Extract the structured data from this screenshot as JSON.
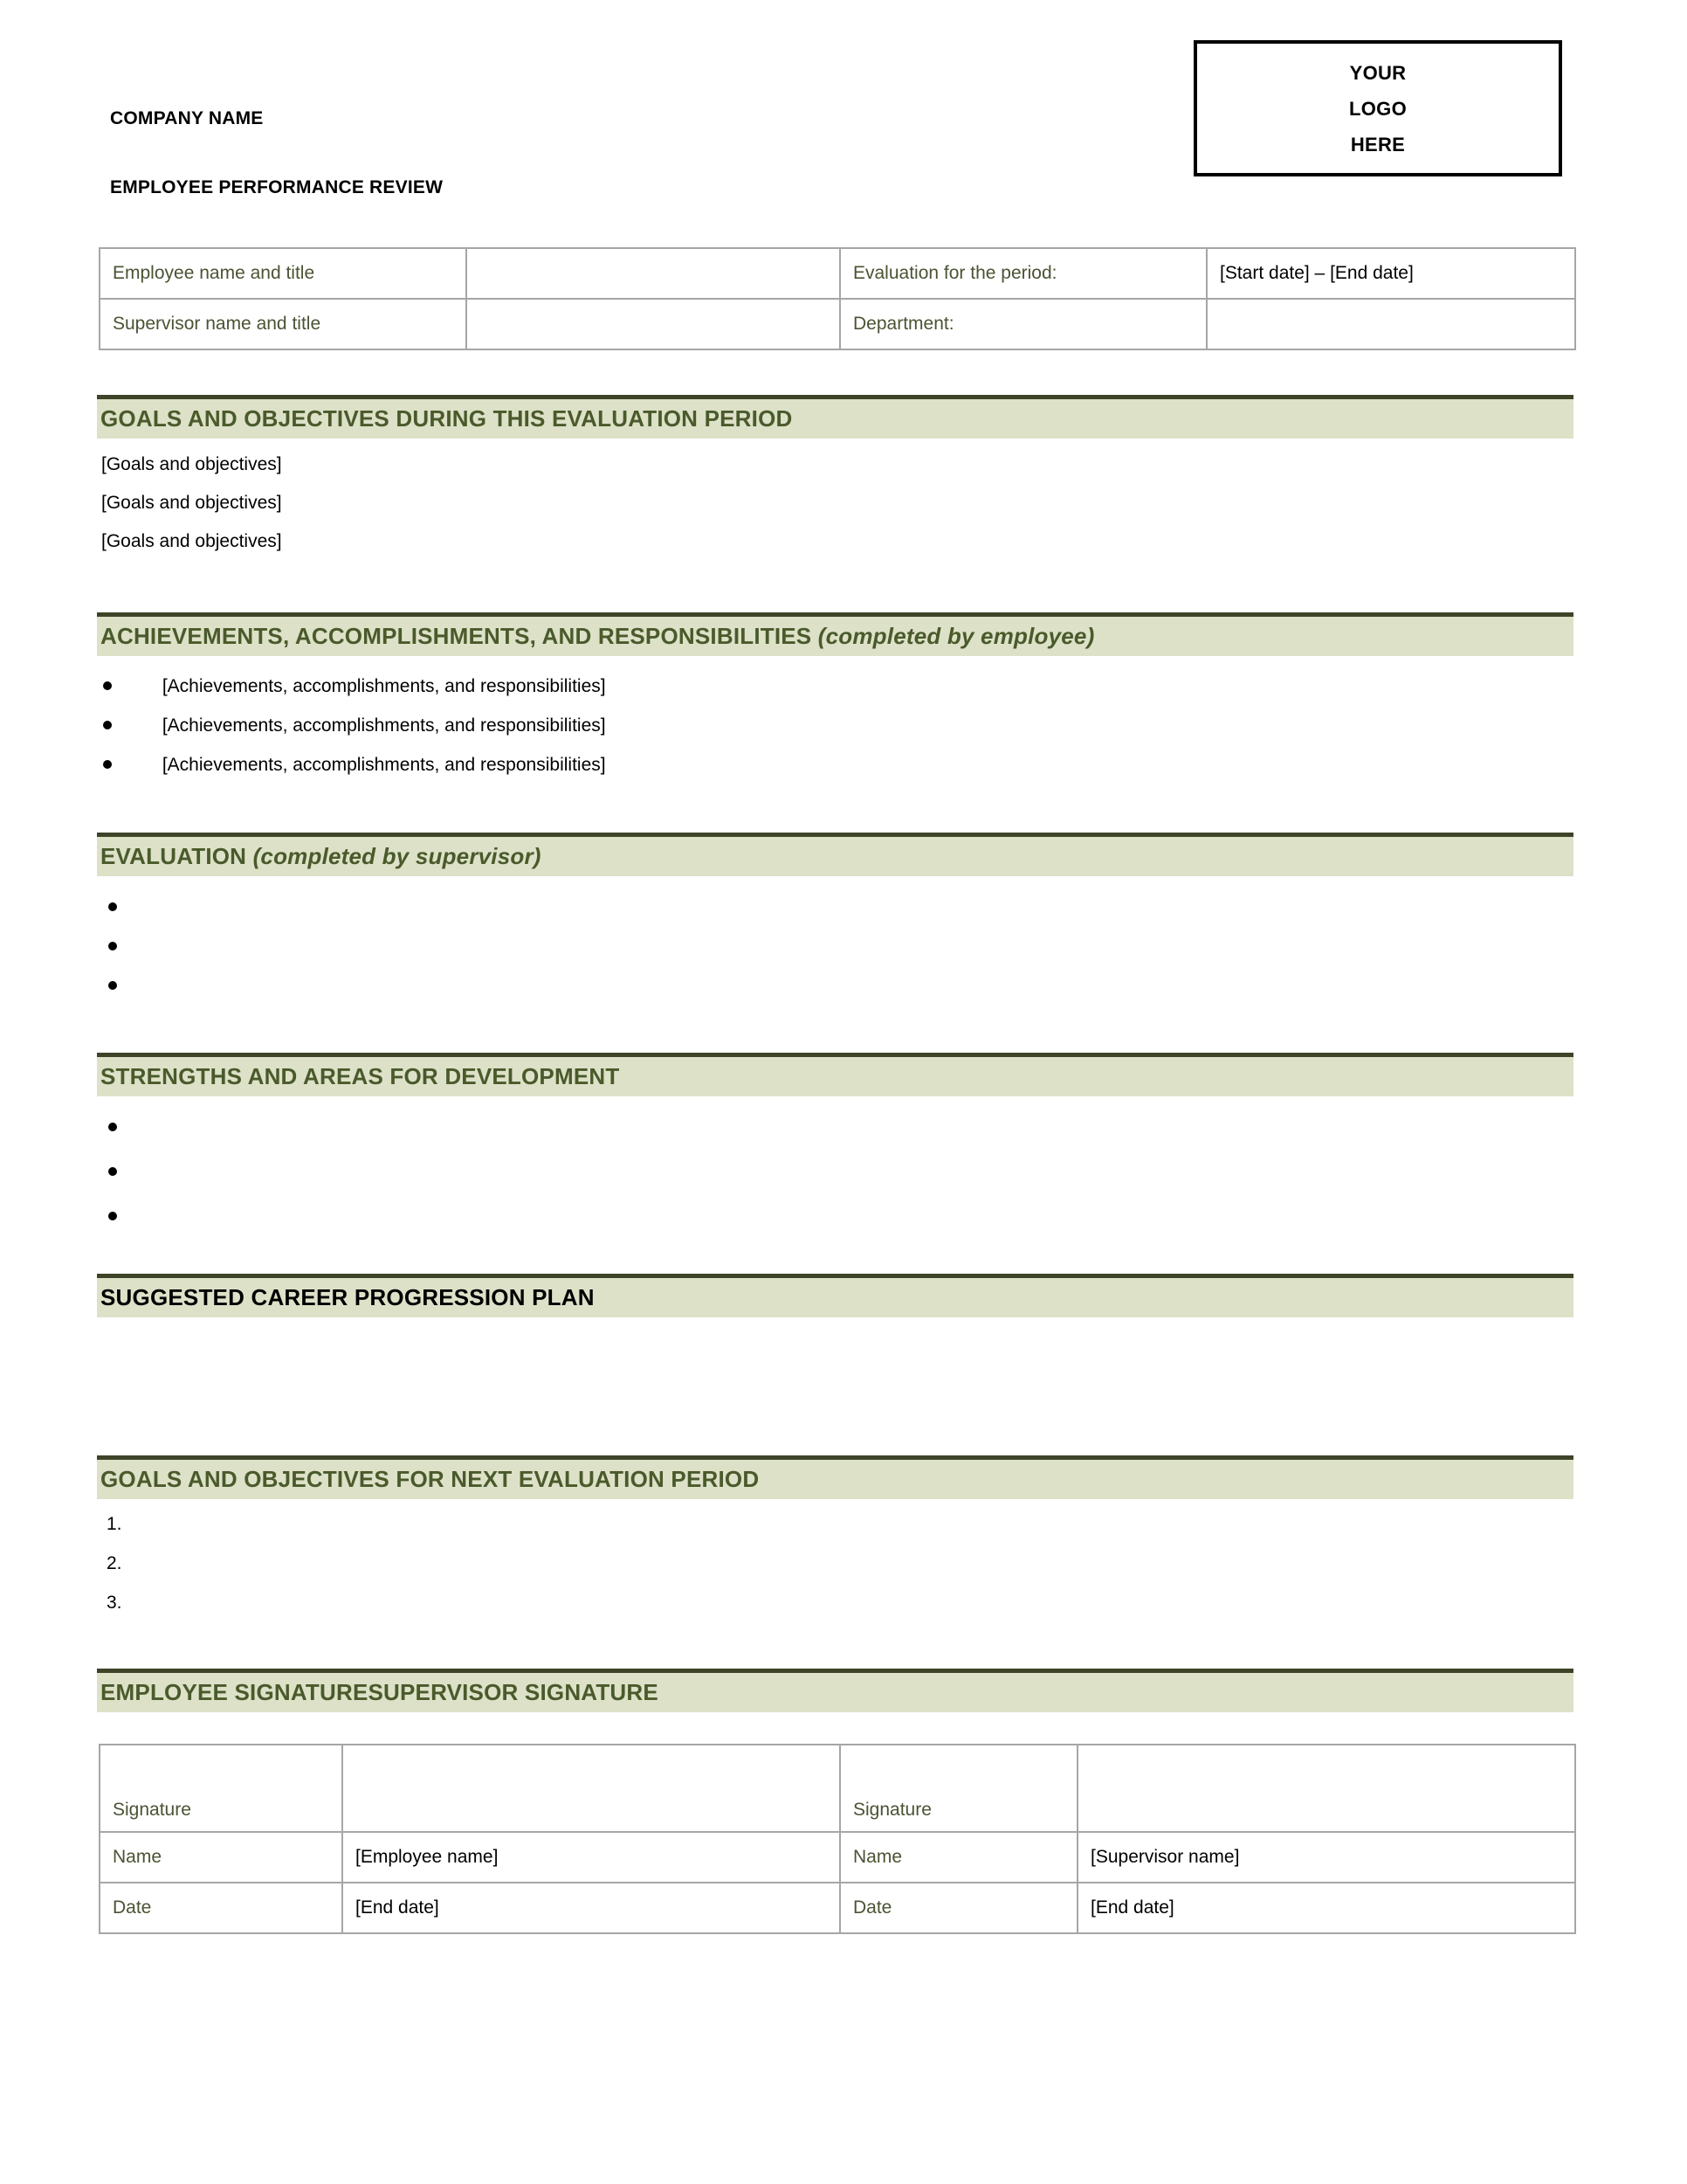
{
  "header": {
    "company_name": "COMPANY NAME",
    "document_title": "EMPLOYEE PERFORMANCE REVIEW",
    "logo_placeholder": {
      "line1": "YOUR",
      "line2": "LOGO",
      "line3": "HERE"
    }
  },
  "info_table": {
    "rows": [
      {
        "label_left": "Employee name and title",
        "value_left": "",
        "label_right": "Evaluation for the period:",
        "value_right": "[Start date] – [End date]"
      },
      {
        "label_left": "Supervisor name and title",
        "value_left": "",
        "label_right": "Department:",
        "value_right": ""
      }
    ]
  },
  "sections": {
    "goals_current": {
      "heading": "GOALS AND OBJECTIVES DURING THIS EVALUATION PERIOD",
      "lines": [
        "[Goals and objectives]",
        "[Goals and objectives]",
        "[Goals and objectives]"
      ]
    },
    "achievements": {
      "heading_main": "ACHIEVEMENTS, ACCOMPLISHMENTS, AND RESPONSIBILITIES ",
      "heading_italic": "(completed by employee)",
      "bullets": [
        "[Achievements, accomplishments, and responsibilities]",
        "[Achievements, accomplishments, and responsibilities]",
        "[Achievements, accomplishments, and responsibilities]"
      ]
    },
    "evaluation": {
      "heading_main": "EVALUATION ",
      "heading_italic": "(completed by supervisor)",
      "bullets": [
        "",
        "",
        ""
      ]
    },
    "strengths": {
      "heading": "STRENGTHS AND AREAS FOR DEVELOPMENT",
      "bullets": [
        "",
        "",
        ""
      ]
    },
    "career_plan": {
      "heading": "SUGGESTED CAREER PROGRESSION PLAN",
      "body": ""
    },
    "goals_next": {
      "heading": "GOALS AND OBJECTIVES FOR NEXT EVALUATION PERIOD",
      "items": [
        {
          "marker": "1.",
          "text": ""
        },
        {
          "marker": "2.",
          "text": ""
        },
        {
          "marker": "3.",
          "text": ""
        }
      ]
    },
    "signatures": {
      "heading": "EMPLOYEE SIGNATURESUPERVISOR SIGNATURE",
      "rows": [
        {
          "label_left": "Signature",
          "value_left": "",
          "label_right": "Signature",
          "value_right": ""
        },
        {
          "label_left": "Name",
          "value_left": "[Employee name]",
          "label_right": "Name",
          "value_right": "[Supervisor name]"
        },
        {
          "label_left": "Date",
          "value_left": "[End date]",
          "label_right": "Date",
          "value_right": "[End date]"
        }
      ]
    }
  },
  "colors": {
    "bar_fill": "#dde1c8",
    "bar_rule": "#3d4428",
    "heading_text": "#4a5a2b",
    "table_label_text": "#4a5333",
    "table_border": "#a6a6a6"
  }
}
